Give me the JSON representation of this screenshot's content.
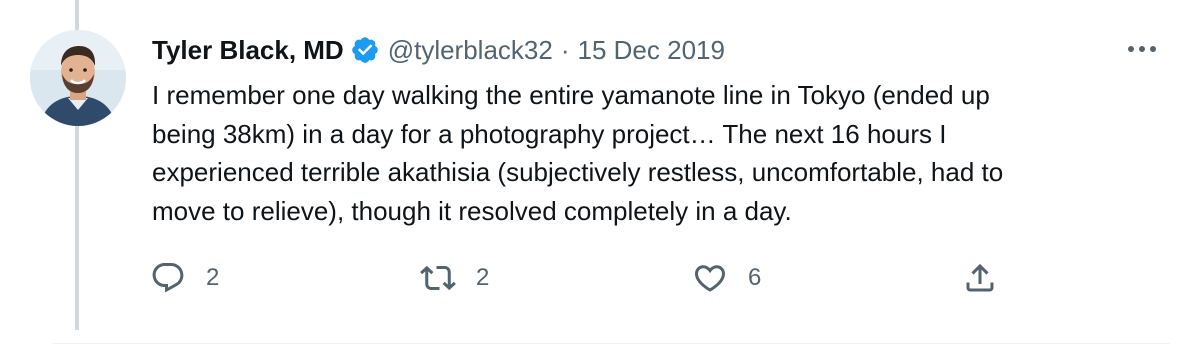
{
  "tweet": {
    "author_name": "Tyler Black, MD",
    "handle": "@tylerblack32",
    "separator": "·",
    "date": "15 Dec 2019",
    "body_lines": [
      "I remember one day walking the entire yamanote line in Tokyo (ended up",
      "being 38km) in a day for a photography project… The next 16 hours I",
      "experienced terrible akathisia (subjectively restless, uncomfortable, had to",
      "move to relieve), though it resolved completely in a day."
    ],
    "replies": "2",
    "retweets": "2",
    "likes": "6"
  },
  "icons": {
    "verified": "verified-badge-icon",
    "more": "more-horizontal-icon",
    "reply": "reply-icon",
    "retweet": "retweet-icon",
    "like": "heart-icon",
    "share": "share-icon"
  },
  "colors": {
    "text": "#0f1419",
    "secondary": "#536471",
    "verified": "#1d9bf0",
    "thread_line": "#cfd9de"
  }
}
